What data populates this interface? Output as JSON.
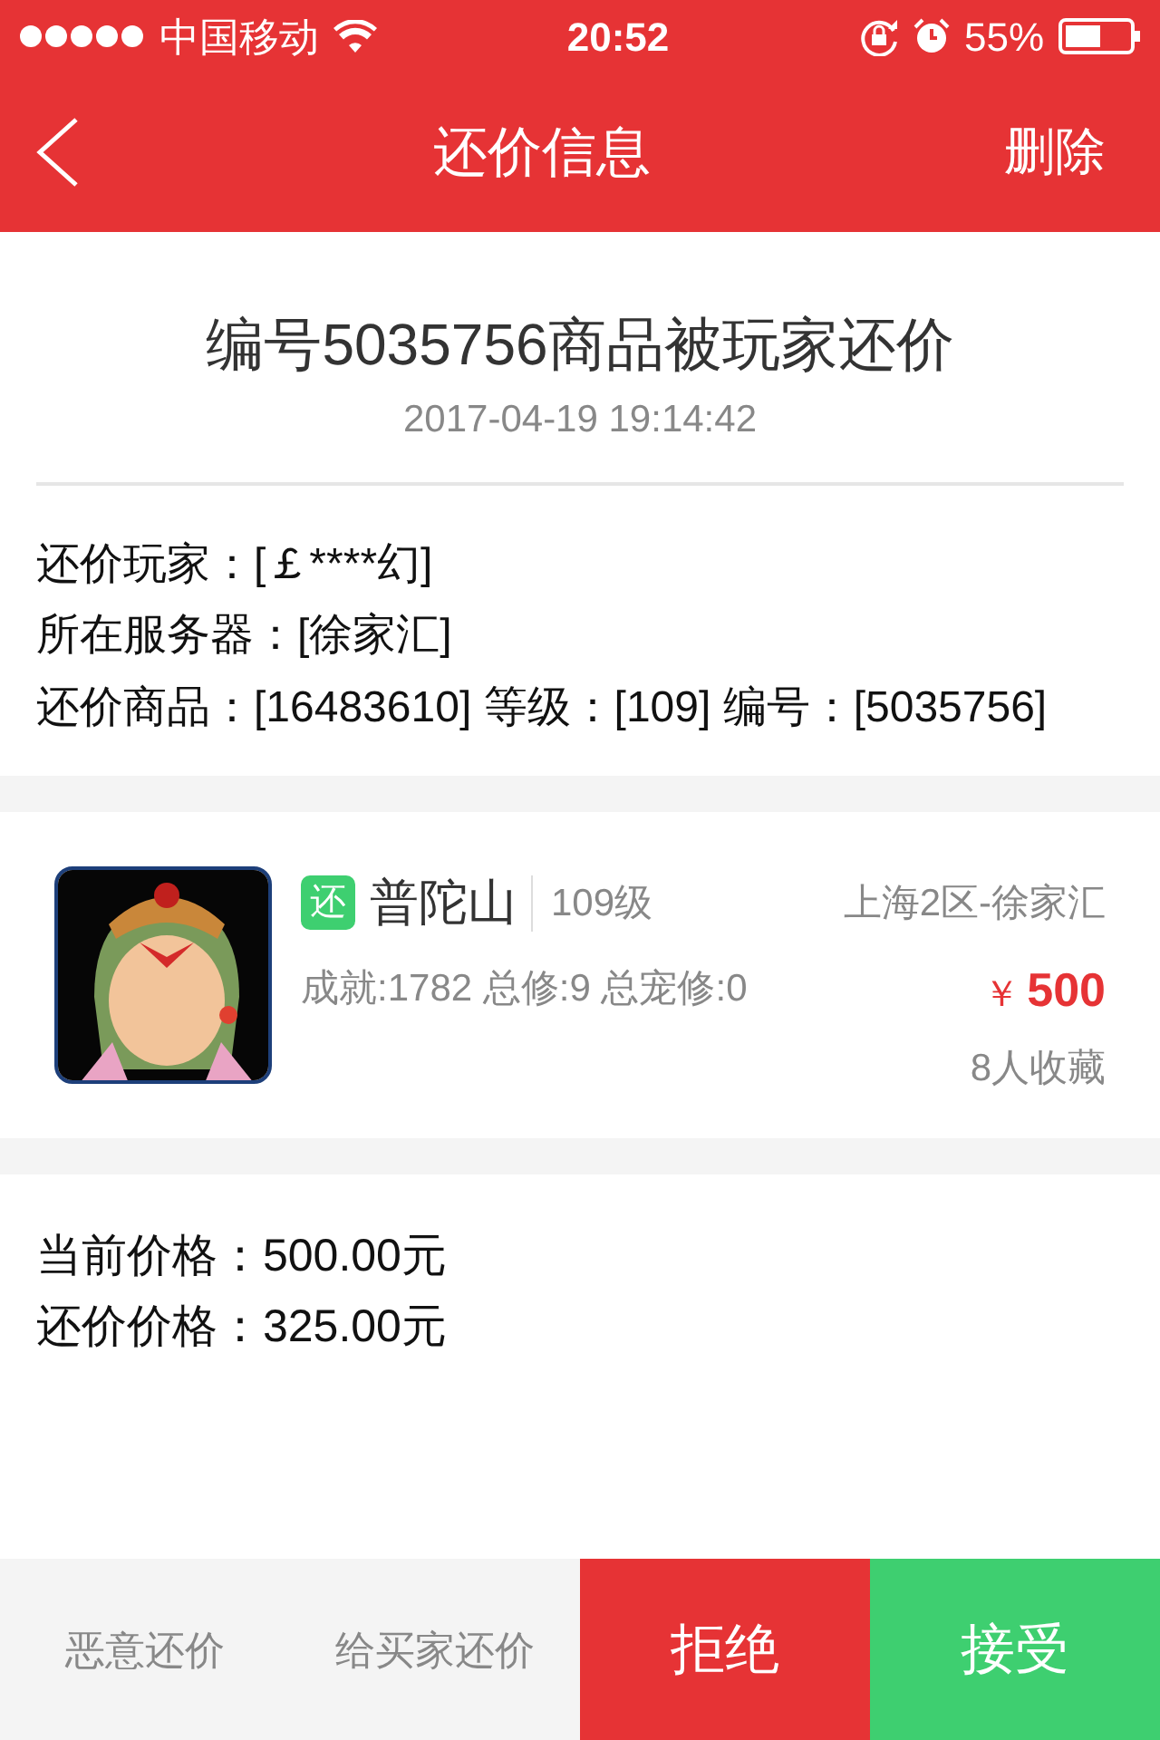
{
  "status_bar": {
    "carrier": "中国移动",
    "time": "20:52",
    "battery": "55%"
  },
  "nav": {
    "title": "还价信息",
    "action": "删除"
  },
  "notice": {
    "title": "编号5035756商品被玩家还价",
    "date": "2017-04-19 19:14:42",
    "lines": [
      "还价玩家：[￡****幻]",
      "所在服务器：[徐家汇]",
      "还价商品：[16483610] 等级：[109] 编号：[5035756]"
    ]
  },
  "item": {
    "tag": "还",
    "name": "普陀山",
    "level": "109级",
    "server": "上海2区-徐家汇",
    "stats": "成就:1782 总修:9 总宠修:0",
    "currency": "￥",
    "price": "500",
    "favorites": "8人收藏"
  },
  "prices": [
    "当前价格：500.00元",
    "还价价格：325.00元"
  ],
  "actions": [
    {
      "label": "恶意还价",
      "kind": "plain"
    },
    {
      "label": "给买家还价",
      "kind": "plain"
    },
    {
      "label": "拒绝",
      "kind": "reject"
    },
    {
      "label": "接受",
      "kind": "accept"
    }
  ]
}
